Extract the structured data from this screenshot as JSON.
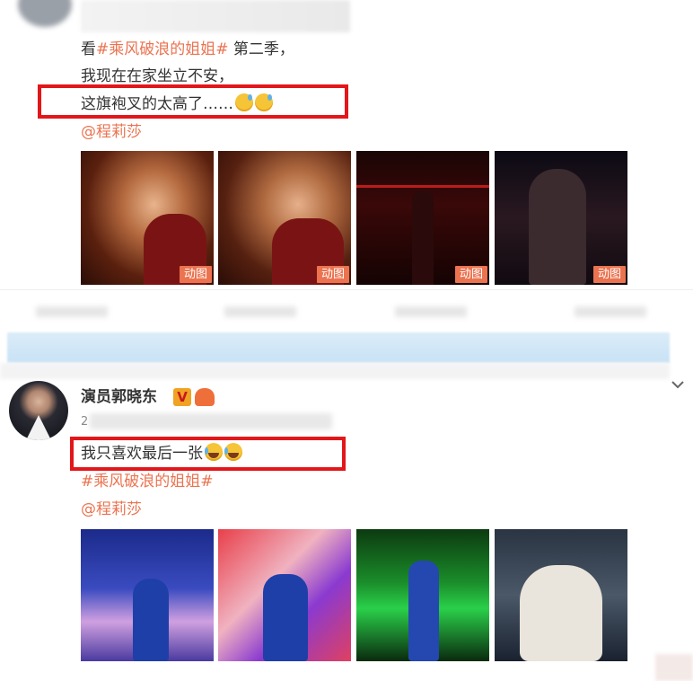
{
  "post1": {
    "line1_prefix": "看",
    "line1_topic": "#乘风破浪的姐姐#",
    "line1_suffix": " 第二季，",
    "line2": "我现在在家坐立不安，",
    "line3": "这旗袍叉的太高了……",
    "line3_emojis": [
      "sweat-face-icon",
      "sweat-face-icon"
    ],
    "mention": "@程莉莎",
    "images": [
      {
        "badge": "动图"
      },
      {
        "badge": "动图"
      },
      {
        "badge": "动图"
      },
      {
        "badge": "动图"
      }
    ]
  },
  "post2": {
    "author": "演员郭晓东",
    "verified_badge": "V",
    "timestamp_partial": "2",
    "line1": "我只喜欢最后一张",
    "line1_emojis": [
      "laugh-cry-face-icon",
      "laugh-cry-face-icon"
    ],
    "topic": "#乘风破浪的姐姐#",
    "mention": "@程莉莎"
  },
  "colors": {
    "accent": "#eb7350",
    "highlight_box": "#e3161a",
    "text": "#333333"
  }
}
